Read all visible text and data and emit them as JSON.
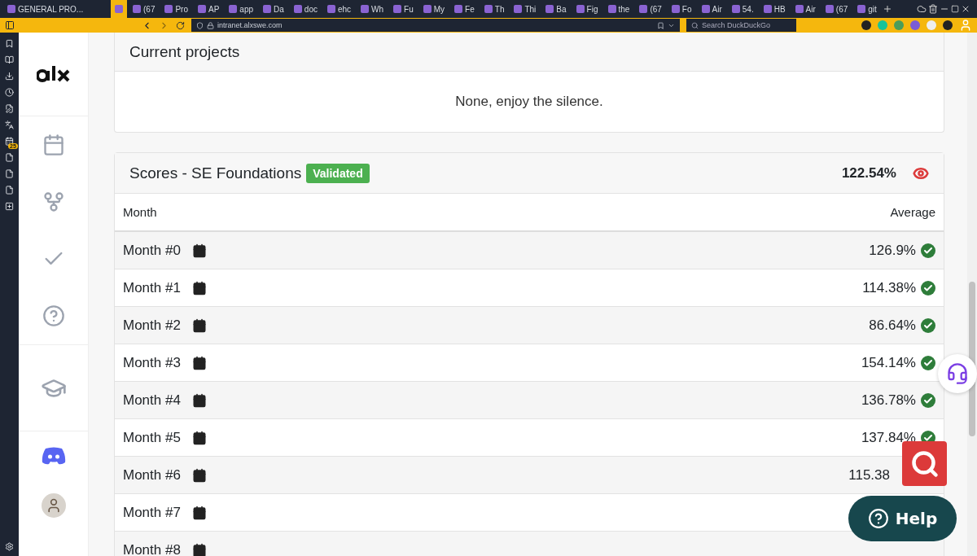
{
  "browser": {
    "tabs": [
      {
        "label": "GENERAL PRO...",
        "selected": false
      },
      {
        "selected": true
      },
      {
        "label": "(67",
        "selected": false
      },
      {
        "label": "Pro",
        "selected": false
      },
      {
        "label": "AP",
        "selected": false
      },
      {
        "label": "app",
        "selected": false
      },
      {
        "label": "Da",
        "selected": false
      },
      {
        "label": "doc",
        "selected": false
      },
      {
        "label": "ehc",
        "selected": false
      },
      {
        "label": "Wh",
        "selected": false
      },
      {
        "label": "Fu",
        "selected": false
      },
      {
        "label": "My",
        "selected": false
      },
      {
        "label": "Fe",
        "selected": false
      },
      {
        "label": "Th",
        "selected": false
      },
      {
        "label": "Thi",
        "selected": false
      },
      {
        "label": "Ba",
        "selected": false
      },
      {
        "label": "Fig",
        "selected": false
      },
      {
        "label": "the",
        "selected": false
      },
      {
        "label": "(67",
        "selected": false
      },
      {
        "label": "Fo",
        "selected": false
      },
      {
        "label": "Air",
        "selected": false
      },
      {
        "label": "54.",
        "selected": false
      },
      {
        "label": "HB",
        "selected": false
      },
      {
        "label": "Air",
        "selected": false
      },
      {
        "label": "(67",
        "selected": false
      },
      {
        "label": "git",
        "selected": false
      }
    ],
    "address": "intranet.alxswe.com",
    "search_placeholder": "Search DuckDuckGo",
    "panel_badge": "25"
  },
  "projects": {
    "title": "Current projects",
    "empty": "None, enjoy the silence."
  },
  "scores": {
    "title": "Scores - SE Foundations",
    "badge": "Validated",
    "total": "122.54%",
    "columns": [
      "Month",
      "Average"
    ],
    "rows": [
      {
        "month": "Month #0",
        "average": "126.9%",
        "passed": true
      },
      {
        "month": "Month #1",
        "average": "114.38%",
        "passed": true
      },
      {
        "month": "Month #2",
        "average": "86.64%",
        "passed": true
      },
      {
        "month": "Month #3",
        "average": "154.14%",
        "passed": true
      },
      {
        "month": "Month #4",
        "average": "136.78%",
        "passed": true
      },
      {
        "month": "Month #5",
        "average": "137.84%",
        "passed": true
      },
      {
        "month": "Month #6",
        "average": "115.38",
        "passed": false
      },
      {
        "month": "Month #7",
        "passed": false
      },
      {
        "month": "Month #8",
        "passed": false
      }
    ]
  },
  "help": {
    "label": "Help"
  }
}
